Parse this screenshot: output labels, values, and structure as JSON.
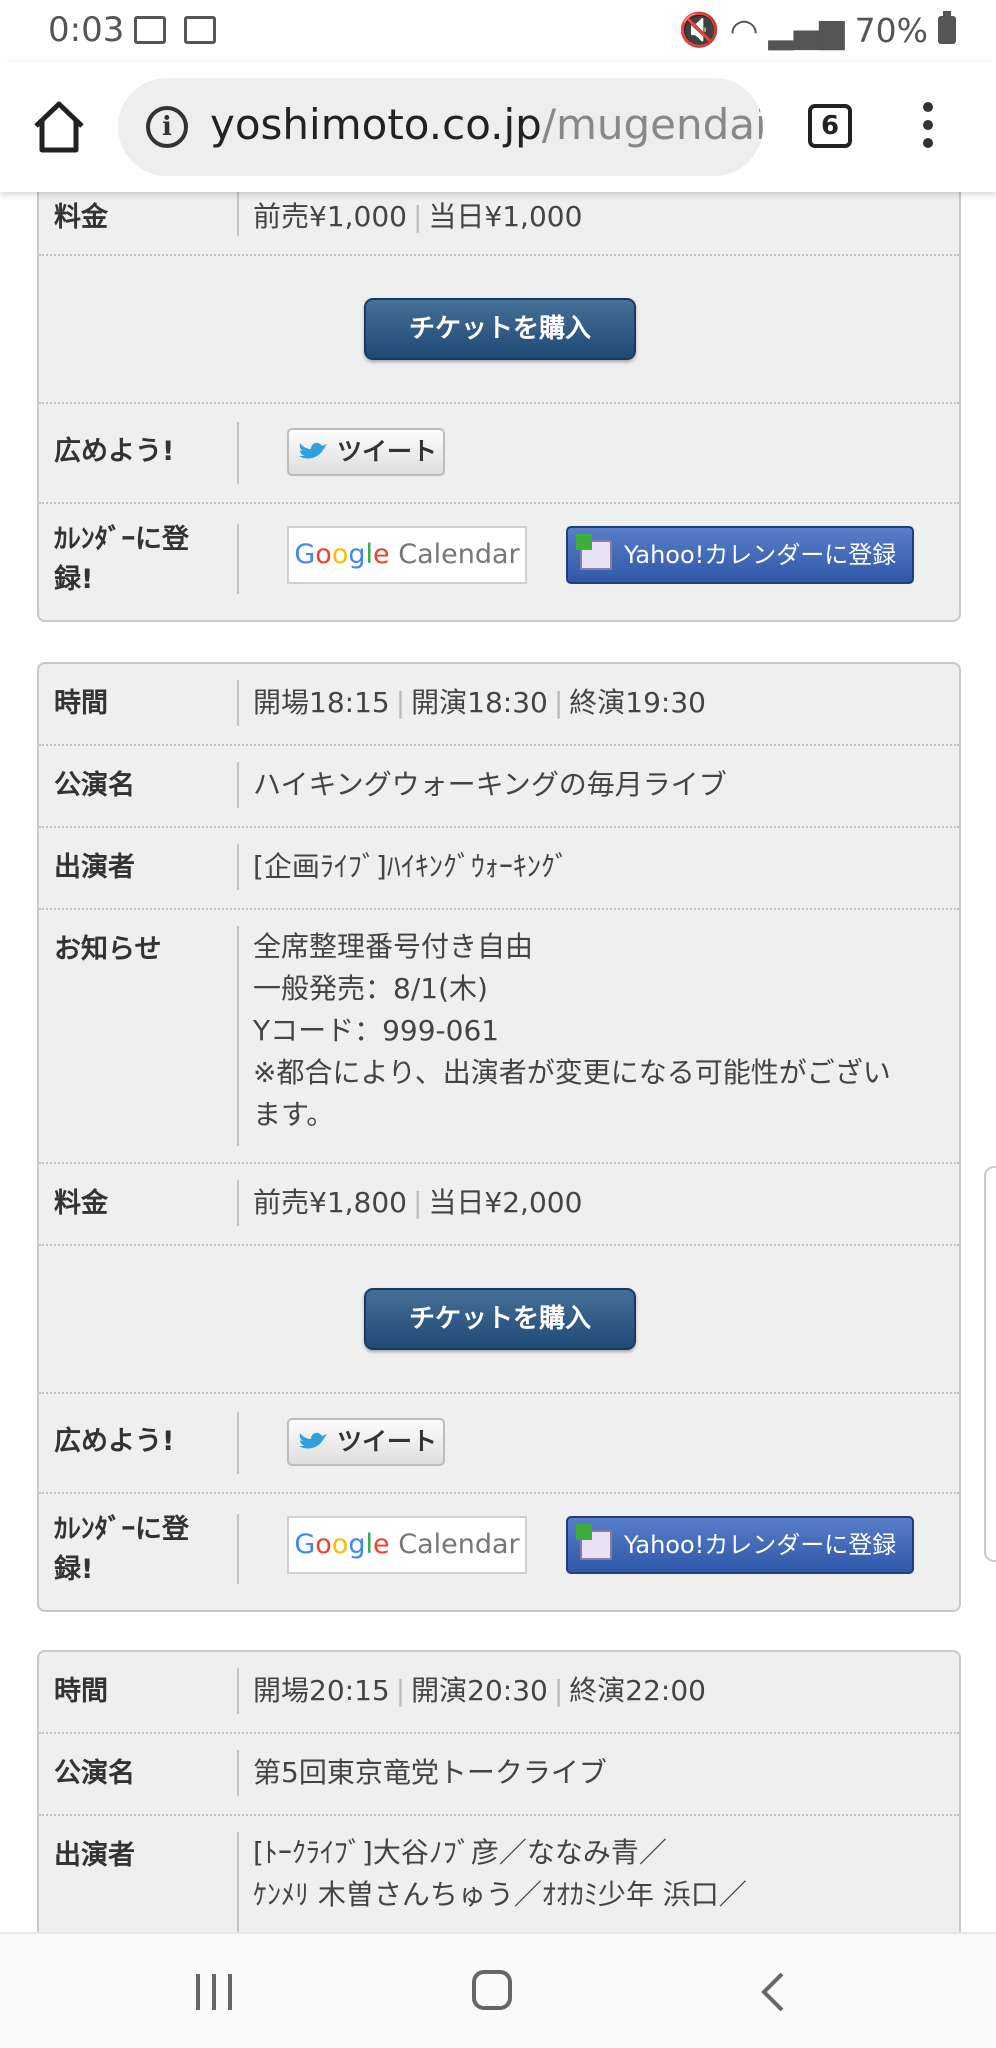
{
  "status_bar": {
    "time": "0:03",
    "battery": "70%"
  },
  "browser": {
    "url_domain": "yoshimoto.co.jp",
    "url_path": "/mugendai_c",
    "tab_count": "6"
  },
  "labels": {
    "time": "時間",
    "show_name": "公演名",
    "performers": "出演者",
    "notice": "お知らせ",
    "price": "料金",
    "share": "広めよう!",
    "calendar_line1": "ｶﾚﾝﾀﾞｰに登",
    "calendar_line2": "録!"
  },
  "buttons": {
    "buy_ticket": "チケットを購入",
    "tweet": "ツイート",
    "google_calendar_g": [
      "G",
      "o",
      "o",
      "g",
      "l",
      "e"
    ],
    "google_calendar_suffix": " Calendar",
    "yahoo_calendar": "Yahoo!カレンダーに登録"
  },
  "event1": {
    "price_advance": "前売¥1,000",
    "price_door": "当日¥1,000"
  },
  "event2": {
    "open": "開場18:15",
    "start": "開演18:30",
    "end": "終演19:30",
    "title": "ハイキングウォーキングの毎月ライブ",
    "performers": "[企画ﾗｲﾌﾞ]ﾊｲｷﾝｸﾞｳｫｰｷﾝｸﾞ",
    "notice": [
      "全席整理番号付き自由",
      "一般発売：8/1(木)",
      "Yコード：999-061",
      "※都合により、出演者が変更になる可能性がござい",
      "ます。"
    ],
    "price_advance": "前売¥1,800",
    "price_door": "当日¥2,000"
  },
  "event3": {
    "open": "開場20:15",
    "start": "開演20:30",
    "end": "終演22:00",
    "title": "第5回東京竜党トークライブ",
    "performers": [
      "[ﾄｰｸﾗｲﾌﾞ]大谷ﾉﾌﾞ彦／ななみ青／",
      "ｹﾝﾒﾘ 木曽さんちゅう／ｵｵｶﾐ少年 浜口／"
    ]
  }
}
